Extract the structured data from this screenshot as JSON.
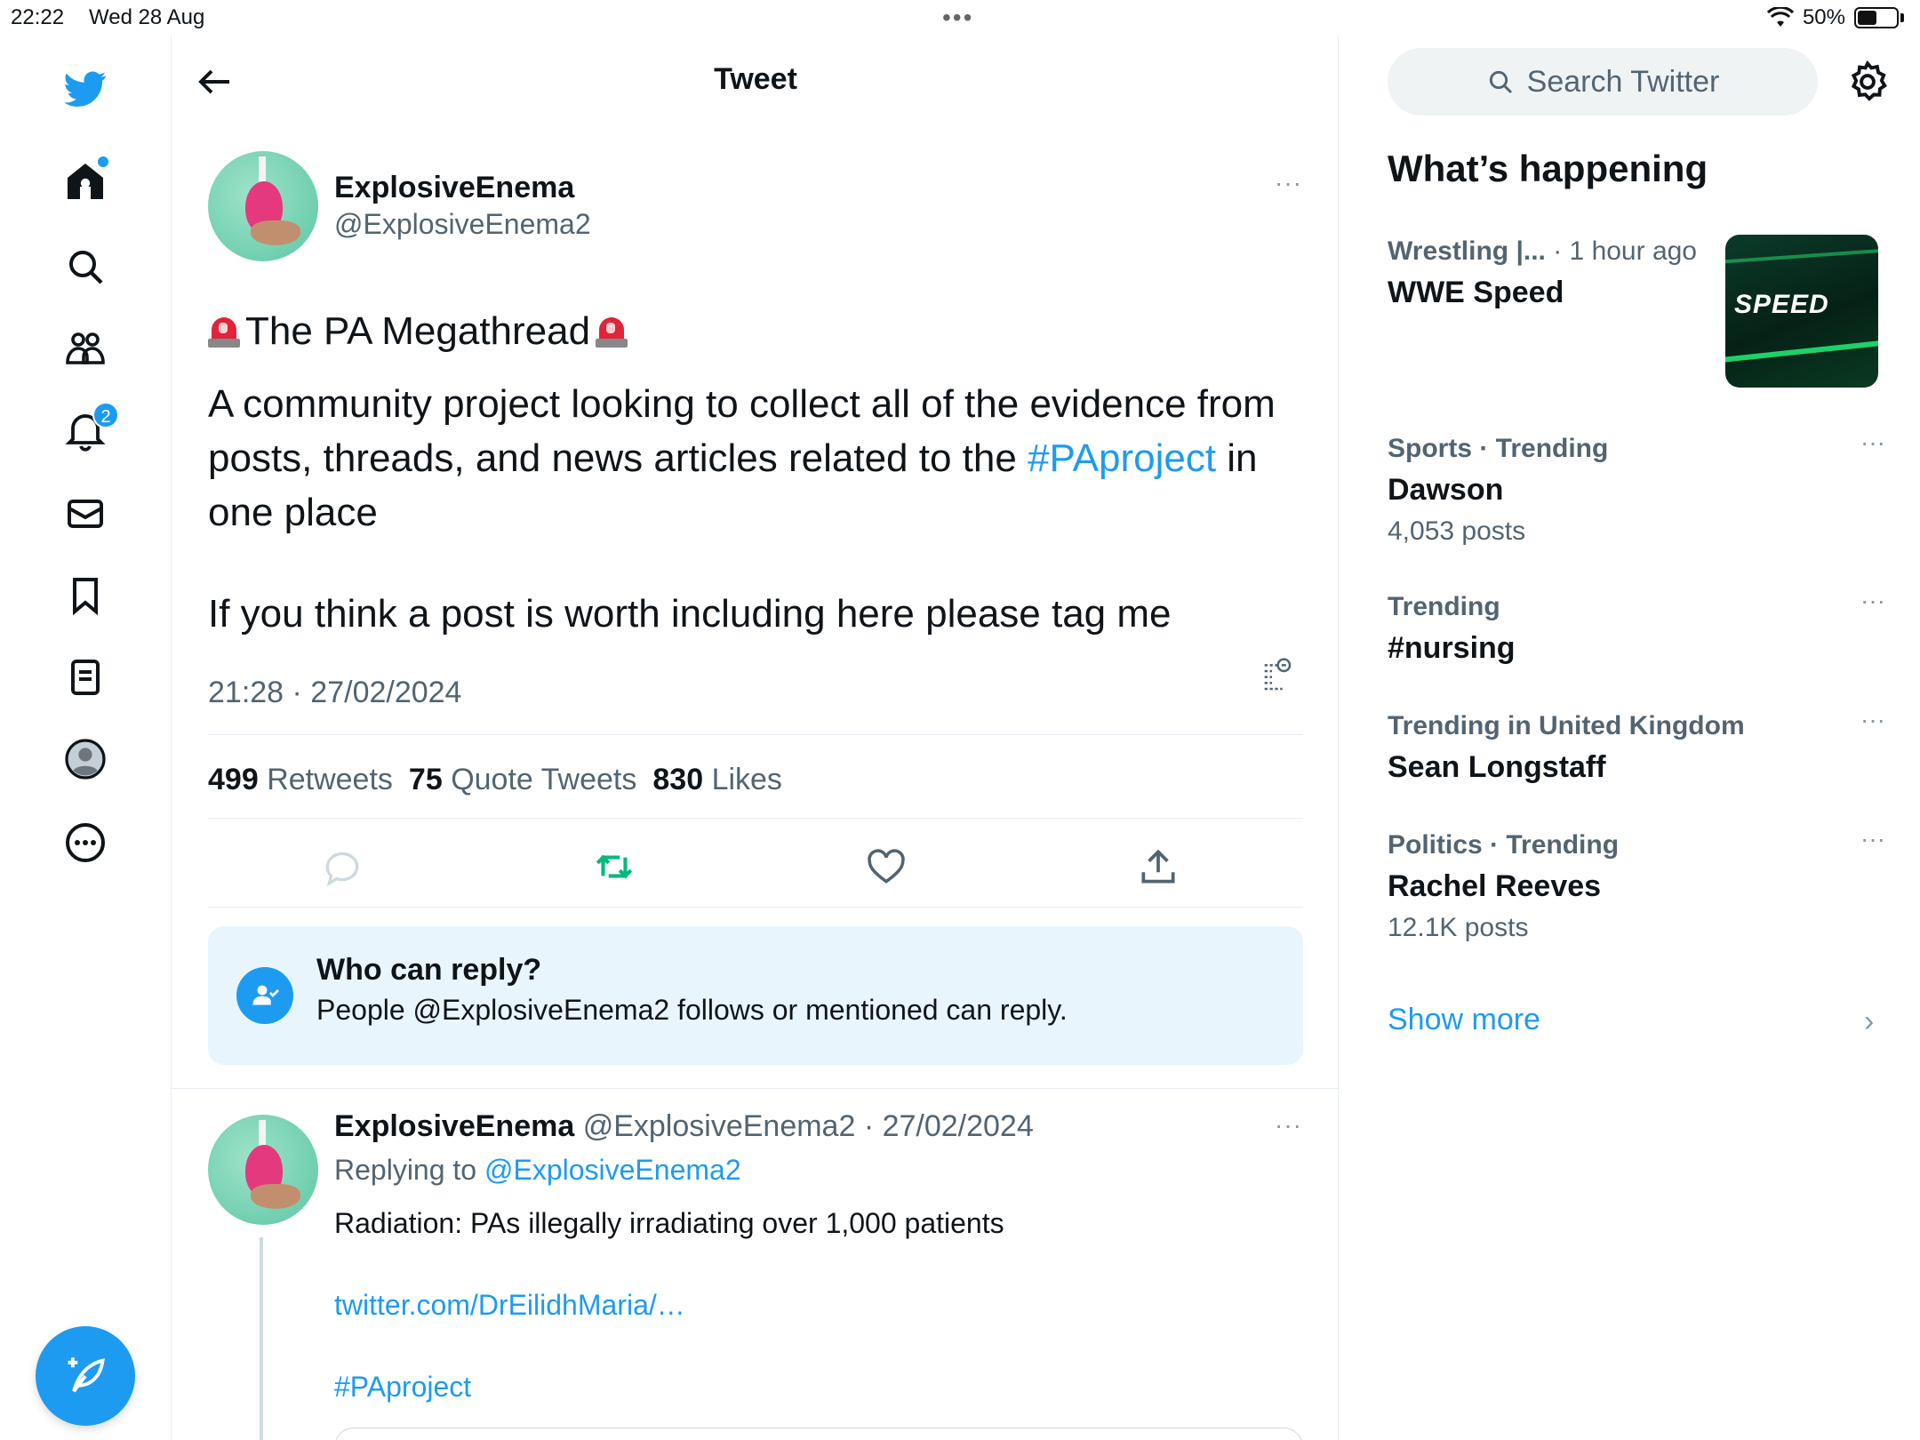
{
  "status_bar": {
    "time": "22:22",
    "date": "Wed 28 Aug",
    "battery": "50%",
    "battery_level": 0.5
  },
  "nav": {
    "notifications_badge": "2",
    "items": [
      "home",
      "explore",
      "communities",
      "notifications",
      "messages",
      "bookmarks",
      "lists",
      "profile",
      "more"
    ]
  },
  "header": {
    "title": "Tweet"
  },
  "tweet": {
    "author_name": "ExplosiveEnema",
    "author_handle": "@ExplosiveEnema2",
    "more": "···",
    "title_text": "The PA Megathread",
    "body_line1": "A community project looking to collect all of the evidence from posts, threads, and news articles related to the ",
    "hashtag": "#PAproject",
    "body_line1_end": " in one place",
    "body_line2": "If you think a post is worth including here please tag me",
    "timestamp": "21:28 · 27/02/2024",
    "retweets_count": "499",
    "retweets_label": "Retweets",
    "quotes_count": "75",
    "quotes_label": "Quote Tweets",
    "likes_count": "830",
    "likes_label": "Likes"
  },
  "who_can_reply": {
    "title": "Who can reply?",
    "text": "People @ExplosiveEnema2 follows or mentioned can reply."
  },
  "reply": {
    "author_name": "ExplosiveEnema",
    "handle_date": "@ExplosiveEnema2 · 27/02/2024",
    "replying_prefix": "Replying to ",
    "replying_to": "@ExplosiveEnema2",
    "text": "Radiation: PAs illegally irradiating over 1,000 patients",
    "link": "twitter.com/DrEilidhMaria/…",
    "hashtag": "#PAproject",
    "more": "···"
  },
  "sidebar": {
    "search_placeholder": "Search Twitter",
    "whats_happening": "What’s happening",
    "trends": [
      {
        "category": "Wrestling |...",
        "time": "· 1 hour ago",
        "name": "WWE Speed",
        "image_label": "SPEED"
      },
      {
        "category": "Sports · Trending",
        "name": "Dawson",
        "count": "4,053 posts",
        "more": "···"
      },
      {
        "category": "Trending",
        "name": "#nursing",
        "more": "···"
      },
      {
        "category": "Trending in United Kingdom",
        "name": "Sean Longstaff",
        "more": "···"
      },
      {
        "category": "Politics · Trending",
        "name": "Rachel Reeves",
        "count": "12.1K posts",
        "more": "···"
      }
    ],
    "show_more": "Show more",
    "chevron": "›"
  },
  "colors": {
    "accent": "#1d9bf0",
    "retweet_active": "#00ba7c",
    "text": "#0f1419",
    "muted": "#536471",
    "reply_box": "#e8f5fd"
  }
}
